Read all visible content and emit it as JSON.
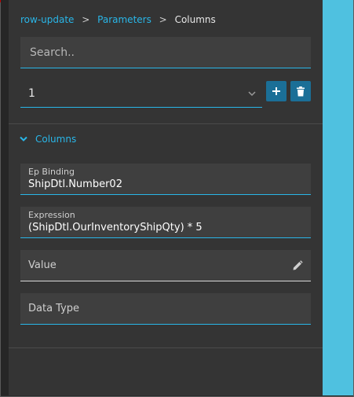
{
  "breadcrumb": {
    "items": [
      "row-update",
      "Parameters",
      "Columns"
    ],
    "separator": ">"
  },
  "search": {
    "placeholder": "Search.."
  },
  "selector": {
    "value": "1"
  },
  "section": {
    "title": "Columns"
  },
  "fields": {
    "ep_binding": {
      "label": "Ep Binding",
      "value": "ShipDtl.Number02"
    },
    "expression": {
      "label": "Expression",
      "value": "(ShipDtl.OurInventoryShipQty) * 5"
    },
    "value": {
      "placeholder": "Value"
    },
    "data_type": {
      "placeholder": "Data Type"
    }
  },
  "colors": {
    "accent": "#29b6e8",
    "button": "#1b6f97",
    "panel": "#343434",
    "field": "#3f3f3f",
    "right_strip": "#4fc1e0"
  },
  "icons": {
    "add": "plus-icon",
    "delete": "trash-icon",
    "select": "chevron-down-icon",
    "section": "chevron-down-icon",
    "edit": "pencil-icon"
  }
}
